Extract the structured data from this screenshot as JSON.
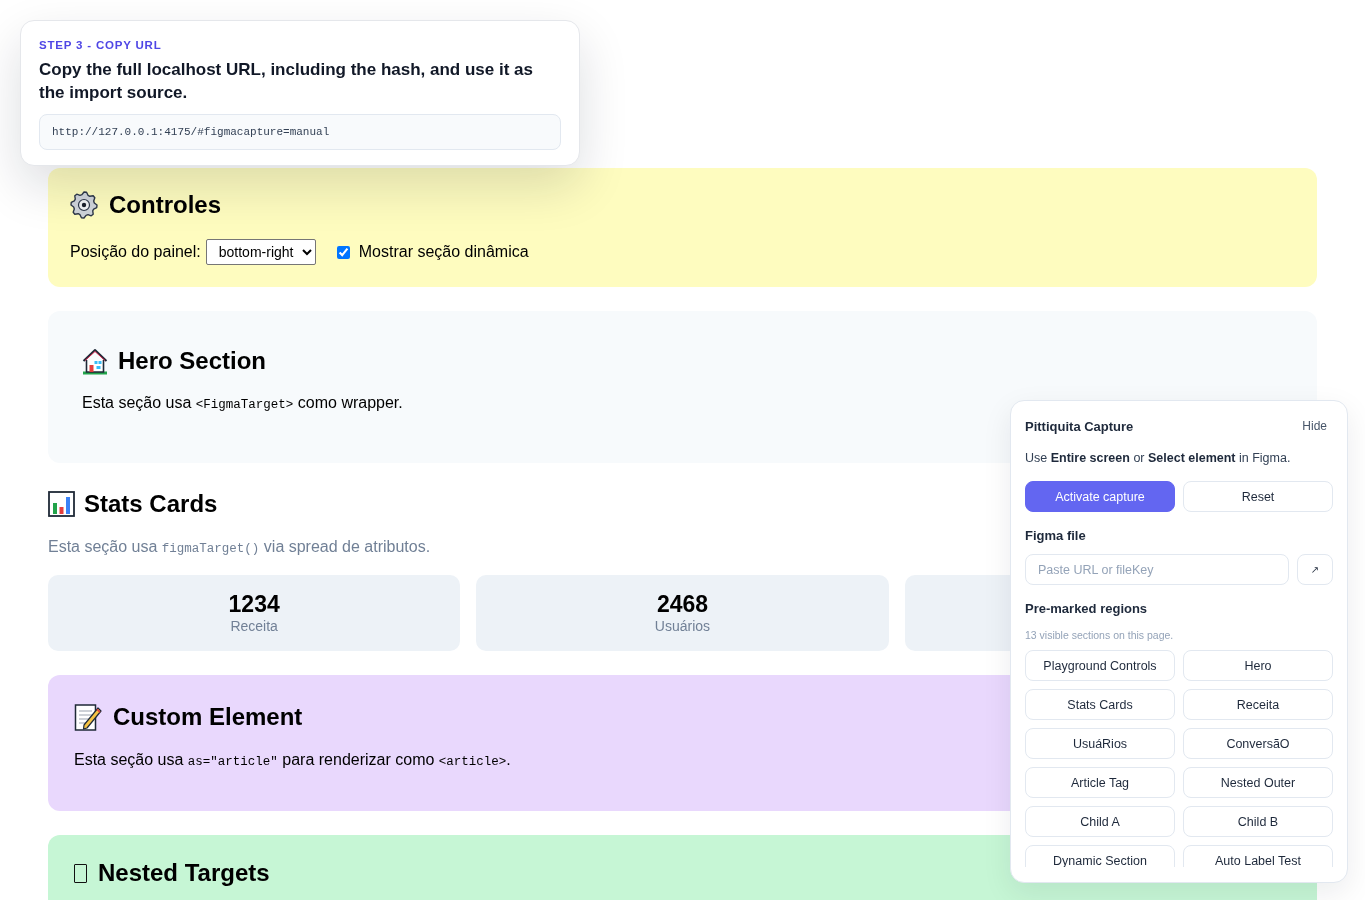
{
  "step_card": {
    "step_label": "STEP 3 - COPY URL",
    "instruction": "Copy the full localhost URL, including the hash, and use it as the import source.",
    "url": "http://127.0.0.1:4175/#figmacapture=manual"
  },
  "sections": [
    {
      "kind": "controls",
      "title": "Controles",
      "color": "#fefcbf",
      "position_label": "Posição do painel:",
      "position_value": "bottom-right",
      "checkbox_label": "Mostrar seção dinâmica",
      "checked": true
    },
    {
      "kind": "hero",
      "title": "Hero Section",
      "color": "#f7fafc",
      "description": [
        {
          "kind": "text",
          "text": "Esta seção usa "
        },
        {
          "kind": "code",
          "text": "<FigmaTarget>"
        },
        {
          "kind": "text",
          "text": " como wrapper."
        }
      ]
    },
    {
      "kind": "stats",
      "title": "Stats Cards",
      "description": [
        {
          "kind": "text",
          "text": "Esta seção usa "
        },
        {
          "kind": "code",
          "text": "figmaTarget()"
        },
        {
          "kind": "text",
          "text": " via spread de atributos."
        }
      ],
      "cards": [
        {
          "kind": "stat",
          "value": "1234",
          "label": "Receita"
        },
        {
          "kind": "stat",
          "value": "2468",
          "label": "Usuários"
        },
        {
          "kind": "covered"
        }
      ]
    },
    {
      "kind": "custom",
      "title": "Custom Element",
      "color": "#e9d8fd",
      "description": [
        {
          "kind": "text",
          "text": "Esta seção usa "
        },
        {
          "kind": "code",
          "text": "as=\"article\""
        },
        {
          "kind": "text",
          "text": " para renderizar como "
        },
        {
          "kind": "code",
          "text": "<article>"
        },
        {
          "kind": "text",
          "text": "."
        }
      ]
    },
    {
      "kind": "nested",
      "title": "Nested Targets",
      "color": "#c6f6d5"
    }
  ],
  "capture_panel": {
    "title": "Pittiquita Capture",
    "hide": "Hide",
    "hint": "Use **Entire screen** or **Select element** in Figma.",
    "buttons": [
      {
        "label": "Activate capture",
        "kind": "primary"
      },
      {
        "label": "Reset",
        "kind": "secondary"
      }
    ],
    "file_label": "Figma file",
    "file_placeholder": "Paste URL or fileKey",
    "open_button": "↗",
    "regions_label": "Pre-marked regions",
    "regions_count": "13 visible sections on this page.",
    "regions": [
      "Playground Controls",
      "Hero",
      "Stats Cards",
      "Receita",
      "UsuáRios",
      "ConversãO",
      "Article Tag",
      "Nested Outer",
      "Child A",
      "Child B",
      "Dynamic Section",
      "Auto Label Test"
    ]
  }
}
